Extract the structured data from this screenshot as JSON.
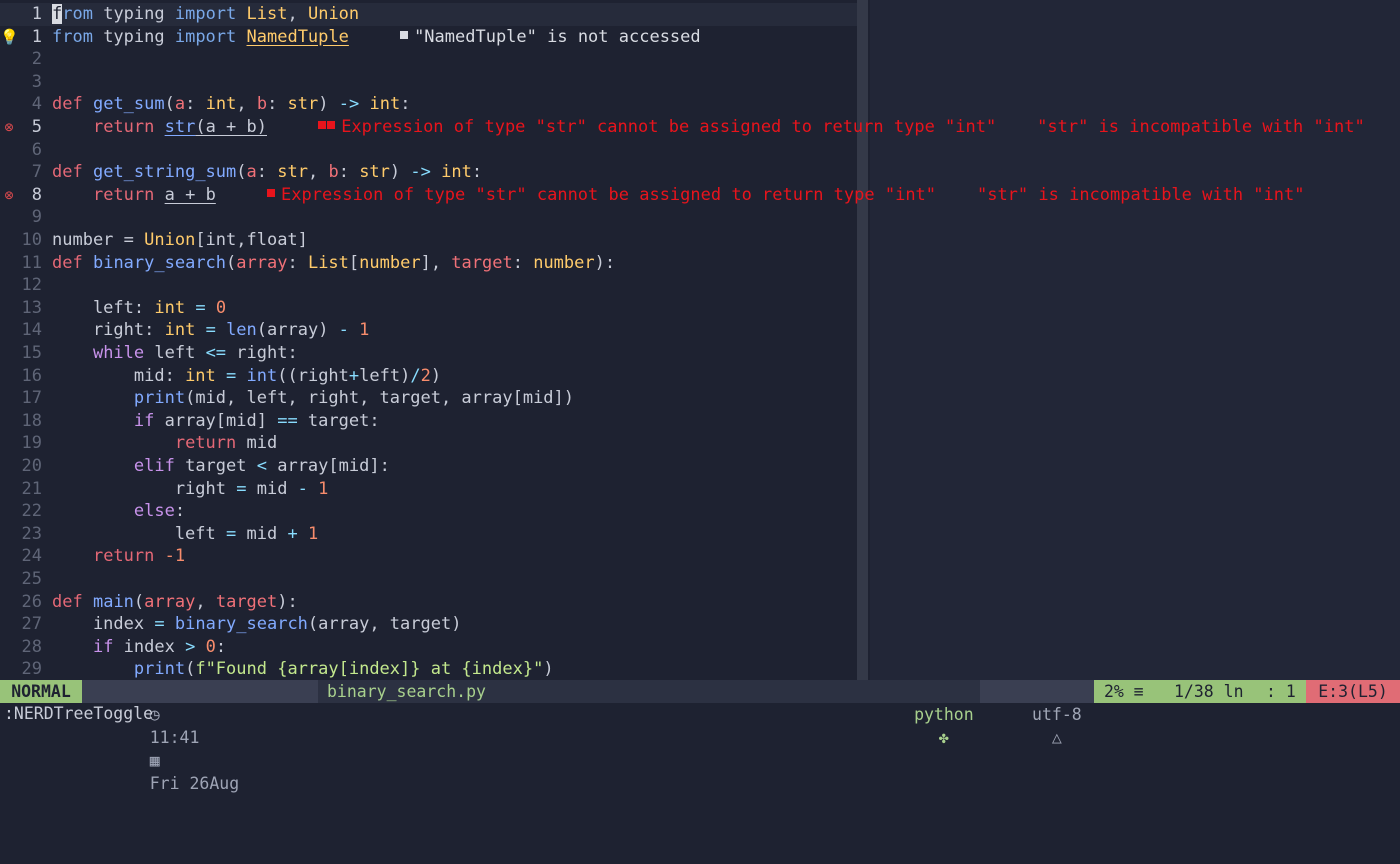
{
  "lines": [
    {
      "sign": "",
      "ln": "1",
      "cur": true,
      "tokens": [
        [
          "cursor",
          "f"
        ],
        [
          "kb",
          "rom"
        ],
        [
          "",
          "typing"
        ],
        [
          "kb",
          "import"
        ],
        [
          "t",
          "List"
        ],
        [
          "",
          "Union"
        ]
      ],
      "raw": [
        [
          "cursor",
          "f"
        ],
        [
          "kb",
          "rom"
        ],
        [
          "",
          " typing "
        ],
        [
          "kb",
          "import"
        ],
        [
          "",
          " "
        ],
        [
          "t",
          "List"
        ],
        [
          "",
          ", "
        ],
        [
          "t",
          "Union"
        ]
      ]
    },
    {
      "sign": "💡",
      "ln": "1",
      "raw": [
        [
          "kb",
          "from"
        ],
        [
          "",
          " typing "
        ],
        [
          "kb",
          "import"
        ],
        [
          "",
          " "
        ],
        [
          "t u",
          "NamedTuple"
        ]
      ],
      "diag": {
        "kind": "warn",
        "squares": 1,
        "text": "\"NamedTuple\" is not accessed"
      }
    },
    {
      "sign": "",
      "ln": "2",
      "raw": []
    },
    {
      "sign": "",
      "ln": "3",
      "raw": []
    },
    {
      "sign": "",
      "ln": "4",
      "raw": [
        [
          "kr",
          "def"
        ],
        [
          "",
          " "
        ],
        [
          "f",
          "get_sum"
        ],
        [
          "",
          "("
        ],
        [
          "p",
          "a"
        ],
        [
          "",
          ": "
        ],
        [
          "t",
          "int"
        ],
        [
          "",
          ", "
        ],
        [
          "p",
          "b"
        ],
        [
          "",
          ": "
        ],
        [
          "t",
          "str"
        ],
        [
          "",
          ") "
        ],
        [
          "o",
          "->"
        ],
        [
          "",
          " "
        ],
        [
          "t",
          "int"
        ],
        [
          "",
          ":"
        ]
      ]
    },
    {
      "sign": "⊗",
      "err": true,
      "ln": "5",
      "raw": [
        [
          "",
          "    "
        ],
        [
          "kr",
          "return"
        ],
        [
          "",
          " "
        ],
        [
          "f u",
          "str"
        ],
        [
          "u",
          "(a + b)"
        ]
      ],
      "diag": {
        "kind": "err",
        "squares": 2,
        "text": "Expression of type \"str\" cannot be assigned to return type \"int\"    \"str\" is incompatible with \"int\""
      }
    },
    {
      "sign": "",
      "ln": "6",
      "raw": []
    },
    {
      "sign": "",
      "ln": "7",
      "raw": [
        [
          "kr",
          "def"
        ],
        [
          "",
          " "
        ],
        [
          "f",
          "get_string_sum"
        ],
        [
          "",
          "("
        ],
        [
          "p",
          "a"
        ],
        [
          "",
          ": "
        ],
        [
          "t",
          "str"
        ],
        [
          "",
          ", "
        ],
        [
          "p",
          "b"
        ],
        [
          "",
          ": "
        ],
        [
          "t",
          "str"
        ],
        [
          "",
          ") "
        ],
        [
          "o",
          "->"
        ],
        [
          "",
          " "
        ],
        [
          "t",
          "int"
        ],
        [
          "",
          ":"
        ]
      ]
    },
    {
      "sign": "⊗",
      "err": true,
      "ln": "8",
      "raw": [
        [
          "",
          "    "
        ],
        [
          "kr",
          "return"
        ],
        [
          "",
          " "
        ],
        [
          "u",
          "a + b"
        ]
      ],
      "diag": {
        "kind": "err",
        "squares": 1,
        "text": "Expression of type \"str\" cannot be assigned to return type \"int\"    \"str\" is incompatible with \"int\""
      }
    },
    {
      "sign": "",
      "ln": "9",
      "raw": []
    },
    {
      "sign": "",
      "ln": "10",
      "raw": [
        [
          "",
          "number = "
        ],
        [
          "t",
          "Union"
        ],
        [
          "",
          "[int,float]"
        ]
      ]
    },
    {
      "sign": "",
      "ln": "11",
      "raw": [
        [
          "kr",
          "def"
        ],
        [
          "",
          " "
        ],
        [
          "f",
          "binary_search"
        ],
        [
          "",
          "("
        ],
        [
          "p",
          "array"
        ],
        [
          "",
          ": "
        ],
        [
          "t",
          "List"
        ],
        [
          "",
          "["
        ],
        [
          "t",
          "number"
        ],
        [
          "",
          "], "
        ],
        [
          "p",
          "target"
        ],
        [
          "",
          ": "
        ],
        [
          "t",
          "number"
        ],
        [
          "",
          "):"
        ]
      ]
    },
    {
      "sign": "",
      "ln": "12",
      "raw": []
    },
    {
      "sign": "",
      "ln": "13",
      "raw": [
        [
          "",
          "    left: "
        ],
        [
          "t",
          "int"
        ],
        [
          "",
          " "
        ],
        [
          "o",
          "="
        ],
        [
          "",
          " "
        ],
        [
          "n",
          "0"
        ]
      ]
    },
    {
      "sign": "",
      "ln": "14",
      "raw": [
        [
          "",
          "    right: "
        ],
        [
          "t",
          "int"
        ],
        [
          "",
          " "
        ],
        [
          "o",
          "="
        ],
        [
          "",
          " "
        ],
        [
          "f",
          "len"
        ],
        [
          "",
          "(array) "
        ],
        [
          "o",
          "-"
        ],
        [
          "",
          " "
        ],
        [
          "n",
          "1"
        ]
      ]
    },
    {
      "sign": "",
      "ln": "15",
      "raw": [
        [
          "",
          "    "
        ],
        [
          "k",
          "while"
        ],
        [
          "",
          " left "
        ],
        [
          "o",
          "<="
        ],
        [
          "",
          " right:"
        ]
      ]
    },
    {
      "sign": "",
      "ln": "16",
      "raw": [
        [
          "",
          "        mid: "
        ],
        [
          "t",
          "int"
        ],
        [
          "",
          " "
        ],
        [
          "o",
          "="
        ],
        [
          "",
          " "
        ],
        [
          "f",
          "int"
        ],
        [
          "",
          "((right"
        ],
        [
          "o",
          "+"
        ],
        [
          "",
          "left)"
        ],
        [
          "o",
          "/"
        ],
        [
          "n",
          "2"
        ],
        [
          "",
          ")"
        ]
      ]
    },
    {
      "sign": "",
      "ln": "17",
      "raw": [
        [
          "",
          "        "
        ],
        [
          "f",
          "print"
        ],
        [
          "",
          "(mid, left, right, target, array[mid])"
        ]
      ]
    },
    {
      "sign": "",
      "ln": "18",
      "raw": [
        [
          "",
          "        "
        ],
        [
          "k",
          "if"
        ],
        [
          "",
          " array[mid] "
        ],
        [
          "o",
          "=="
        ],
        [
          "",
          " target:"
        ]
      ]
    },
    {
      "sign": "",
      "ln": "19",
      "raw": [
        [
          "",
          "            "
        ],
        [
          "kr",
          "return"
        ],
        [
          "",
          " mid"
        ]
      ]
    },
    {
      "sign": "",
      "ln": "20",
      "raw": [
        [
          "",
          "        "
        ],
        [
          "k",
          "elif"
        ],
        [
          "",
          " target "
        ],
        [
          "o",
          "<"
        ],
        [
          "",
          " array[mid]:"
        ]
      ]
    },
    {
      "sign": "",
      "ln": "21",
      "raw": [
        [
          "",
          "            right "
        ],
        [
          "o",
          "="
        ],
        [
          "",
          " mid "
        ],
        [
          "o",
          "-"
        ],
        [
          "",
          " "
        ],
        [
          "n",
          "1"
        ]
      ]
    },
    {
      "sign": "",
      "ln": "22",
      "raw": [
        [
          "",
          "        "
        ],
        [
          "k",
          "else"
        ],
        [
          "",
          ":"
        ]
      ]
    },
    {
      "sign": "",
      "ln": "23",
      "raw": [
        [
          "",
          "            left "
        ],
        [
          "o",
          "="
        ],
        [
          "",
          " mid "
        ],
        [
          "o",
          "+"
        ],
        [
          "",
          " "
        ],
        [
          "n",
          "1"
        ]
      ]
    },
    {
      "sign": "",
      "ln": "24",
      "raw": [
        [
          "",
          "    "
        ],
        [
          "kr",
          "return"
        ],
        [
          "",
          " "
        ],
        [
          "n",
          "-1"
        ]
      ]
    },
    {
      "sign": "",
      "ln": "25",
      "raw": []
    },
    {
      "sign": "",
      "ln": "26",
      "raw": [
        [
          "kr",
          "def"
        ],
        [
          "",
          " "
        ],
        [
          "f",
          "main"
        ],
        [
          "",
          "("
        ],
        [
          "p",
          "array"
        ],
        [
          "",
          ", "
        ],
        [
          "p",
          "target"
        ],
        [
          "",
          "):"
        ]
      ]
    },
    {
      "sign": "",
      "ln": "27",
      "raw": [
        [
          "",
          "    index "
        ],
        [
          "o",
          "="
        ],
        [
          "",
          " "
        ],
        [
          "f",
          "binary_search"
        ],
        [
          "",
          "(array, target)"
        ]
      ]
    },
    {
      "sign": "",
      "ln": "28",
      "raw": [
        [
          "",
          "    "
        ],
        [
          "k",
          "if"
        ],
        [
          "",
          " index "
        ],
        [
          "o",
          ">"
        ],
        [
          "",
          " "
        ],
        [
          "n",
          "0"
        ],
        [
          "",
          ":"
        ]
      ]
    },
    {
      "sign": "",
      "ln": "29",
      "raw": [
        [
          "",
          "        "
        ],
        [
          "f",
          "print"
        ],
        [
          "",
          "("
        ],
        [
          "s",
          "f\"Found {array[index]} at {index}\""
        ],
        [
          "",
          ")"
        ]
      ]
    }
  ],
  "statusline": {
    "mode": "NORMAL",
    "time": "11:41",
    "date": "Fri 26Aug",
    "filename": "binary_search.py",
    "filetype": "python",
    "encoding": "utf-8",
    "percent": "2% ≡",
    "line_info": "1/38 ln",
    "col_info": ": 1",
    "errors": "E:3(L5)"
  },
  "cmdline": ":NERDTreeToggle"
}
